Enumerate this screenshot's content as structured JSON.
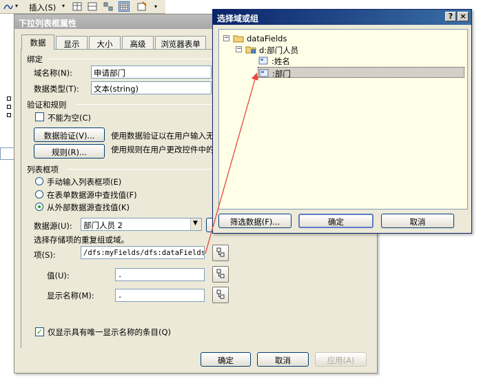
{
  "toolbar": {
    "insert_label": "插入(S)"
  },
  "main_dialog": {
    "title": "下拉列表框属性",
    "tabs": [
      "数据",
      "显示",
      "大小",
      "高级",
      "浏览器表单"
    ],
    "binding": {
      "group_label": "绑定",
      "field_name_label": "域名称(N):",
      "field_name_value": "申请部门",
      "data_type_label": "数据类型(T):",
      "data_type_value": "文本(string)"
    },
    "validation": {
      "group_label": "验证和规则",
      "not_empty_label": "不能为空(C)",
      "not_empty_checked": false,
      "validate_button": "数据验证(V)...",
      "validate_desc": "使用数据验证以在用户输入无",
      "rules_button": "规则(R)...",
      "rules_desc": "使用规则在用户更改控件中的"
    },
    "list_items": {
      "group_label": "列表框项",
      "options": [
        "手动输入列表框项(E)",
        "在表单数据源中查找值(F)",
        "从外部数据源查找值(K)"
      ],
      "selected_index": 2,
      "data_source_label": "数据源(U):",
      "data_source_value": "部门人员 2",
      "select_hint": "选择存储项的重复组或域。",
      "entries_label": "项(S):",
      "entries_value": "/dfs:myFields/dfs:dataFields/",
      "value_label": "值(U):",
      "value_value": ".",
      "display_name_label": "显示名称(M):",
      "display_name_value": ".",
      "unique_only_label": "仅显示具有唯一显示名称的条目(Q)",
      "unique_only_checked": true
    },
    "buttons": {
      "ok": "确定",
      "cancel": "取消",
      "apply": "应用(A)"
    }
  },
  "select_dialog": {
    "title": "选择域或组",
    "help": "?",
    "close": "×",
    "tree": [
      {
        "label": "dataFields",
        "level": 0,
        "expander": "−"
      },
      {
        "label": "d:部门人员",
        "level": 1,
        "expander": "−"
      },
      {
        "label": ":姓名",
        "level": 2,
        "expander": ""
      },
      {
        "label": ":部门",
        "level": 2,
        "expander": "",
        "selected": true
      }
    ],
    "buttons": {
      "filter": "筛选数据(F)...",
      "ok": "确定",
      "cancel": "取消"
    }
  },
  "colors": {
    "active_title": "#0a246a",
    "inactive_title": "#a8a8a8",
    "annotation_arrow": "#e8463c",
    "tree_bg": "#ffffe8"
  }
}
